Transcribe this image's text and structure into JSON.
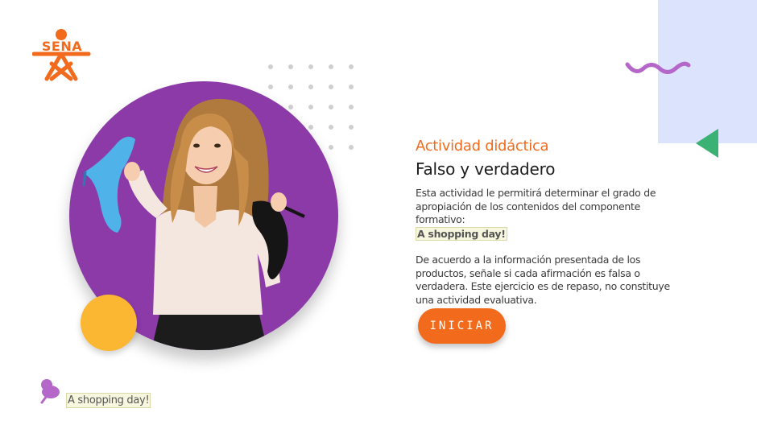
{
  "logo": {
    "text": "SENA",
    "color": "#f26b1d"
  },
  "hero": {
    "circle_color": "#8c3aa8",
    "accent_circle_color": "#fbb731",
    "image_description_icon": "woman-holding-shoes-photo"
  },
  "decor": {
    "panel_color": "#dbe4fc",
    "squiggle_color": "#b467c9",
    "triangle_color": "#3bb273"
  },
  "content": {
    "kicker": "Actividad didáctica",
    "title": "Falso y verdadero",
    "intro": "Esta actividad le permitirá determinar el grado de apropiación de los contenidos del componente formativo:",
    "topic": "A shopping day!",
    "instructions": "De acuerdo a la información presentada de los productos, señale si cada afirmación es falsa o verdadera.  Este ejercicio es de repaso, no constituye una actividad evaluativa.",
    "start_button": "INICIAR"
  },
  "footer": {
    "pin_icon": "pushpin-icon",
    "tag": "A shopping day!"
  }
}
